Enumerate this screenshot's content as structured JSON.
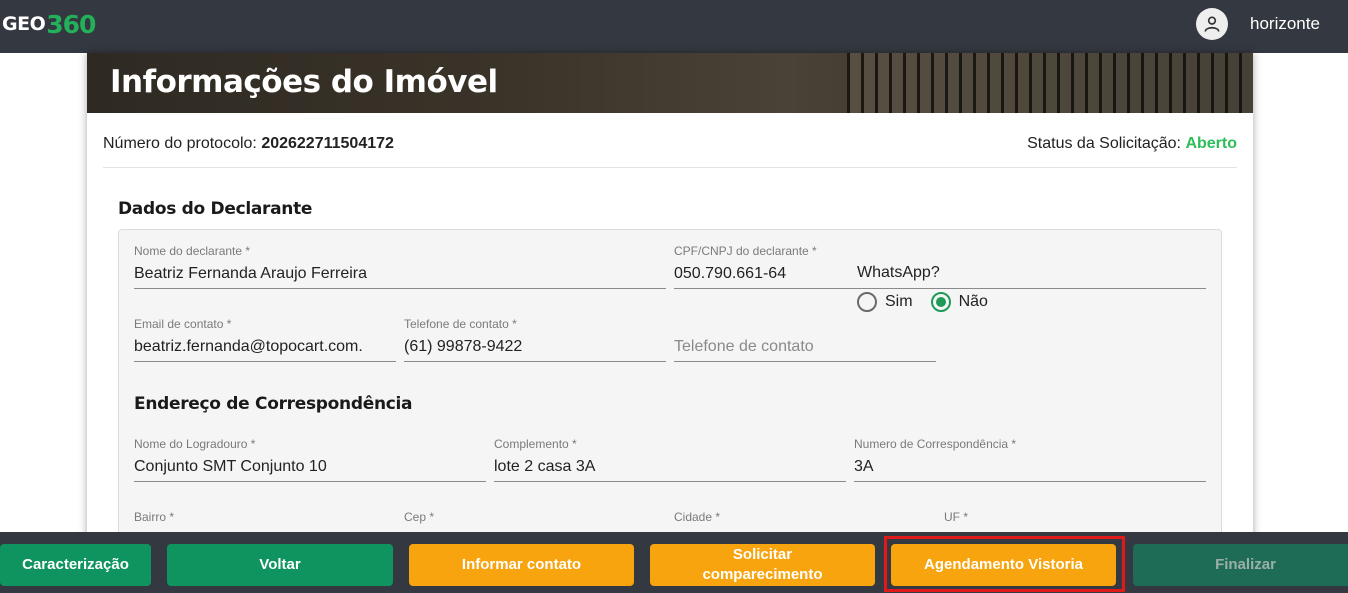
{
  "header": {
    "logo_geo": "GEO",
    "logo_num": "360",
    "username": "horizonte"
  },
  "card": {
    "title": "Informações do Imóvel",
    "protocol_label": "Número do protocolo: ",
    "protocol_value": "202622711504172",
    "status_label": "Status da Solicitação: ",
    "status_value": "Aberto"
  },
  "declarante": {
    "section_title": "Dados do Declarante",
    "nome_label": "Nome do declarante *",
    "nome_value": "Beatriz Fernanda Araujo Ferreira",
    "cpf_label": "CPF/CNPJ do declarante *",
    "cpf_value": "050.790.661-64",
    "email_label": "Email de contato *",
    "email_value": "beatriz.fernanda@topocart.com.",
    "telefone_label": "Telefone de contato *",
    "telefone_value": "(61) 99878-9422",
    "telefone2_placeholder": "Telefone de contato",
    "whatsapp_label": "WhatsApp?",
    "whatsapp_options": [
      "Sim",
      "Não"
    ],
    "whatsapp_selected": "Não"
  },
  "endereco": {
    "section_title": "Endereço de Correspondência",
    "logradouro_label": "Nome do Logradouro *",
    "logradouro_value": "Conjunto SMT Conjunto 10",
    "complemento_label": "Complemento *",
    "complemento_value": "lote 2 casa 3A",
    "numero_label": "Numero de Correspondência *",
    "numero_value": "3A",
    "bairro_label": "Bairro *",
    "cep_label": "Cep *",
    "cidade_label": "Cidade *",
    "uf_label": "UF *"
  },
  "actions": {
    "caracterizacao": "Caracterização",
    "voltar": "Voltar",
    "informar_contato": "Informar contato",
    "solicitar_line1": "Solicitar",
    "solicitar_line2": "comparecimento",
    "agendamento": "Agendamento Vistoria",
    "finalizar": "Finalizar"
  },
  "colors": {
    "topbar": "#343840",
    "green": "#0f9460",
    "orange": "#f7a40e",
    "status_green": "#2ebd59",
    "highlight": "#e01a1a"
  },
  "icons": {
    "user": "user-icon"
  }
}
